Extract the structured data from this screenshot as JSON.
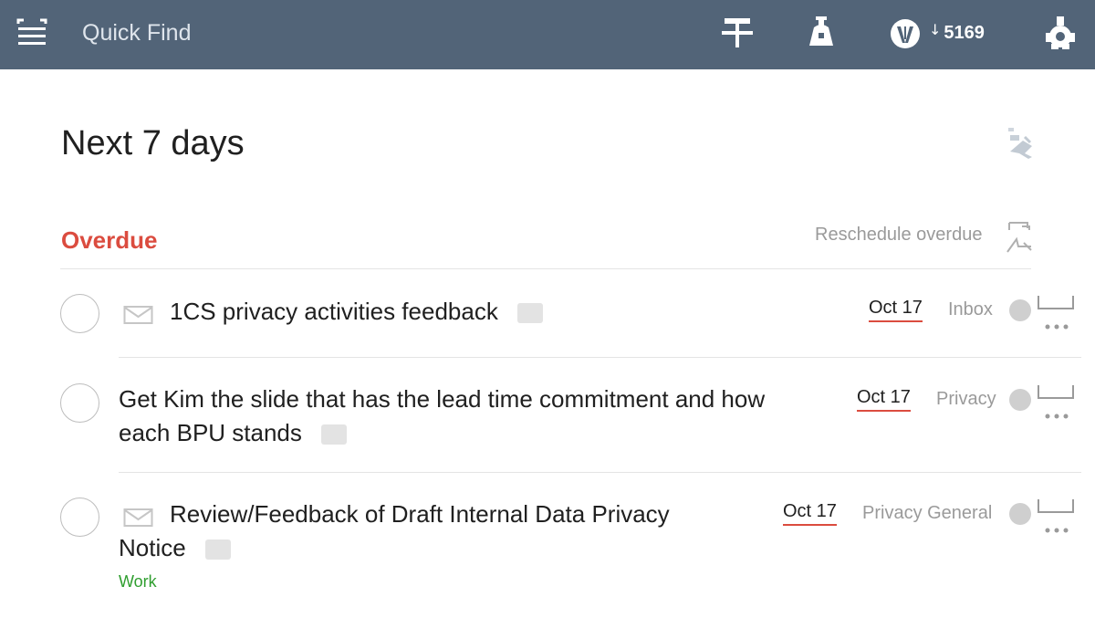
{
  "topbar": {
    "search_placeholder": "Quick Find",
    "karma": {
      "arrow": "↓",
      "count": "5169"
    }
  },
  "view": {
    "title": "Next 7 days"
  },
  "overdue": {
    "title": "Overdue",
    "reschedule_label": "Reschedule overdue",
    "tasks": [
      {
        "content": "1CS privacy activities feedback",
        "due": "Oct 17",
        "project": "Inbox"
      },
      {
        "content_line1": "Get Kim the slide that has the lead time commitment and how",
        "content_line2": "each BPU stands",
        "due": "Oct 17",
        "project": "Privacy"
      },
      {
        "content_line1": "Review/Feedback of Draft Internal Data Privacy",
        "content_line2": "Notice",
        "due": "Oct 17",
        "project": "Privacy General",
        "label": "Work"
      }
    ]
  },
  "colors": {
    "topbar": "#526478",
    "overdue_red": "#db4c3f",
    "label_green": "#2f9e2f",
    "muted_text": "#9a9a9a"
  },
  "icons": {
    "menu": "hamburger-menu-icon",
    "add": "add-task-icon",
    "notifications": "bell-icon",
    "karma": "karma-logo-icon",
    "settings": "gear-icon",
    "view_options": "view-options-icon",
    "reschedule": "reschedule-icon",
    "email": "email-icon",
    "note": "note-icon",
    "comment": "comment-icon",
    "more": "more-options-icon"
  }
}
